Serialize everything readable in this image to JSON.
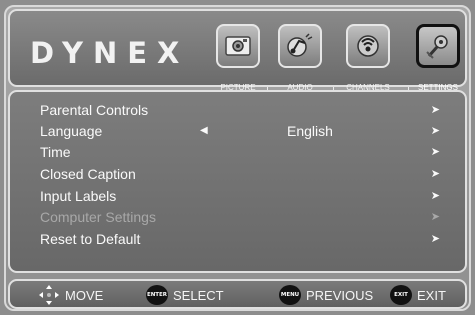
{
  "header": {
    "logo": "DYNEX",
    "tabs": [
      {
        "label": "PICTURE",
        "icon": "picture-icon",
        "active": false
      },
      {
        "label": "AUDIO",
        "icon": "audio-icon",
        "active": false
      },
      {
        "label": "CHANNELS",
        "icon": "channels-icon",
        "active": false
      },
      {
        "label": "SETTINGS",
        "icon": "settings-icon",
        "active": true
      }
    ]
  },
  "menu": {
    "items": [
      {
        "label": "Parental Controls",
        "disabled": false
      },
      {
        "label": "Language",
        "value": "English",
        "disabled": false
      },
      {
        "label": "Time",
        "disabled": false
      },
      {
        "label": "Closed Caption",
        "disabled": false
      },
      {
        "label": "Input Labels",
        "disabled": false
      },
      {
        "label": "Computer Settings",
        "disabled": true
      },
      {
        "label": "Reset to Default",
        "disabled": false
      }
    ]
  },
  "footer": {
    "move": "MOVE",
    "enter_key": "ENTER",
    "select": "SELECT",
    "menu_key": "MENU",
    "previous": "PREVIOUS",
    "exit_key": "EXIT",
    "exit": "EXIT"
  },
  "colors": {
    "background": "#8d8d8d",
    "panel": "#707070",
    "text": "#fafafa",
    "disabled_text": "#a8a8a8"
  }
}
